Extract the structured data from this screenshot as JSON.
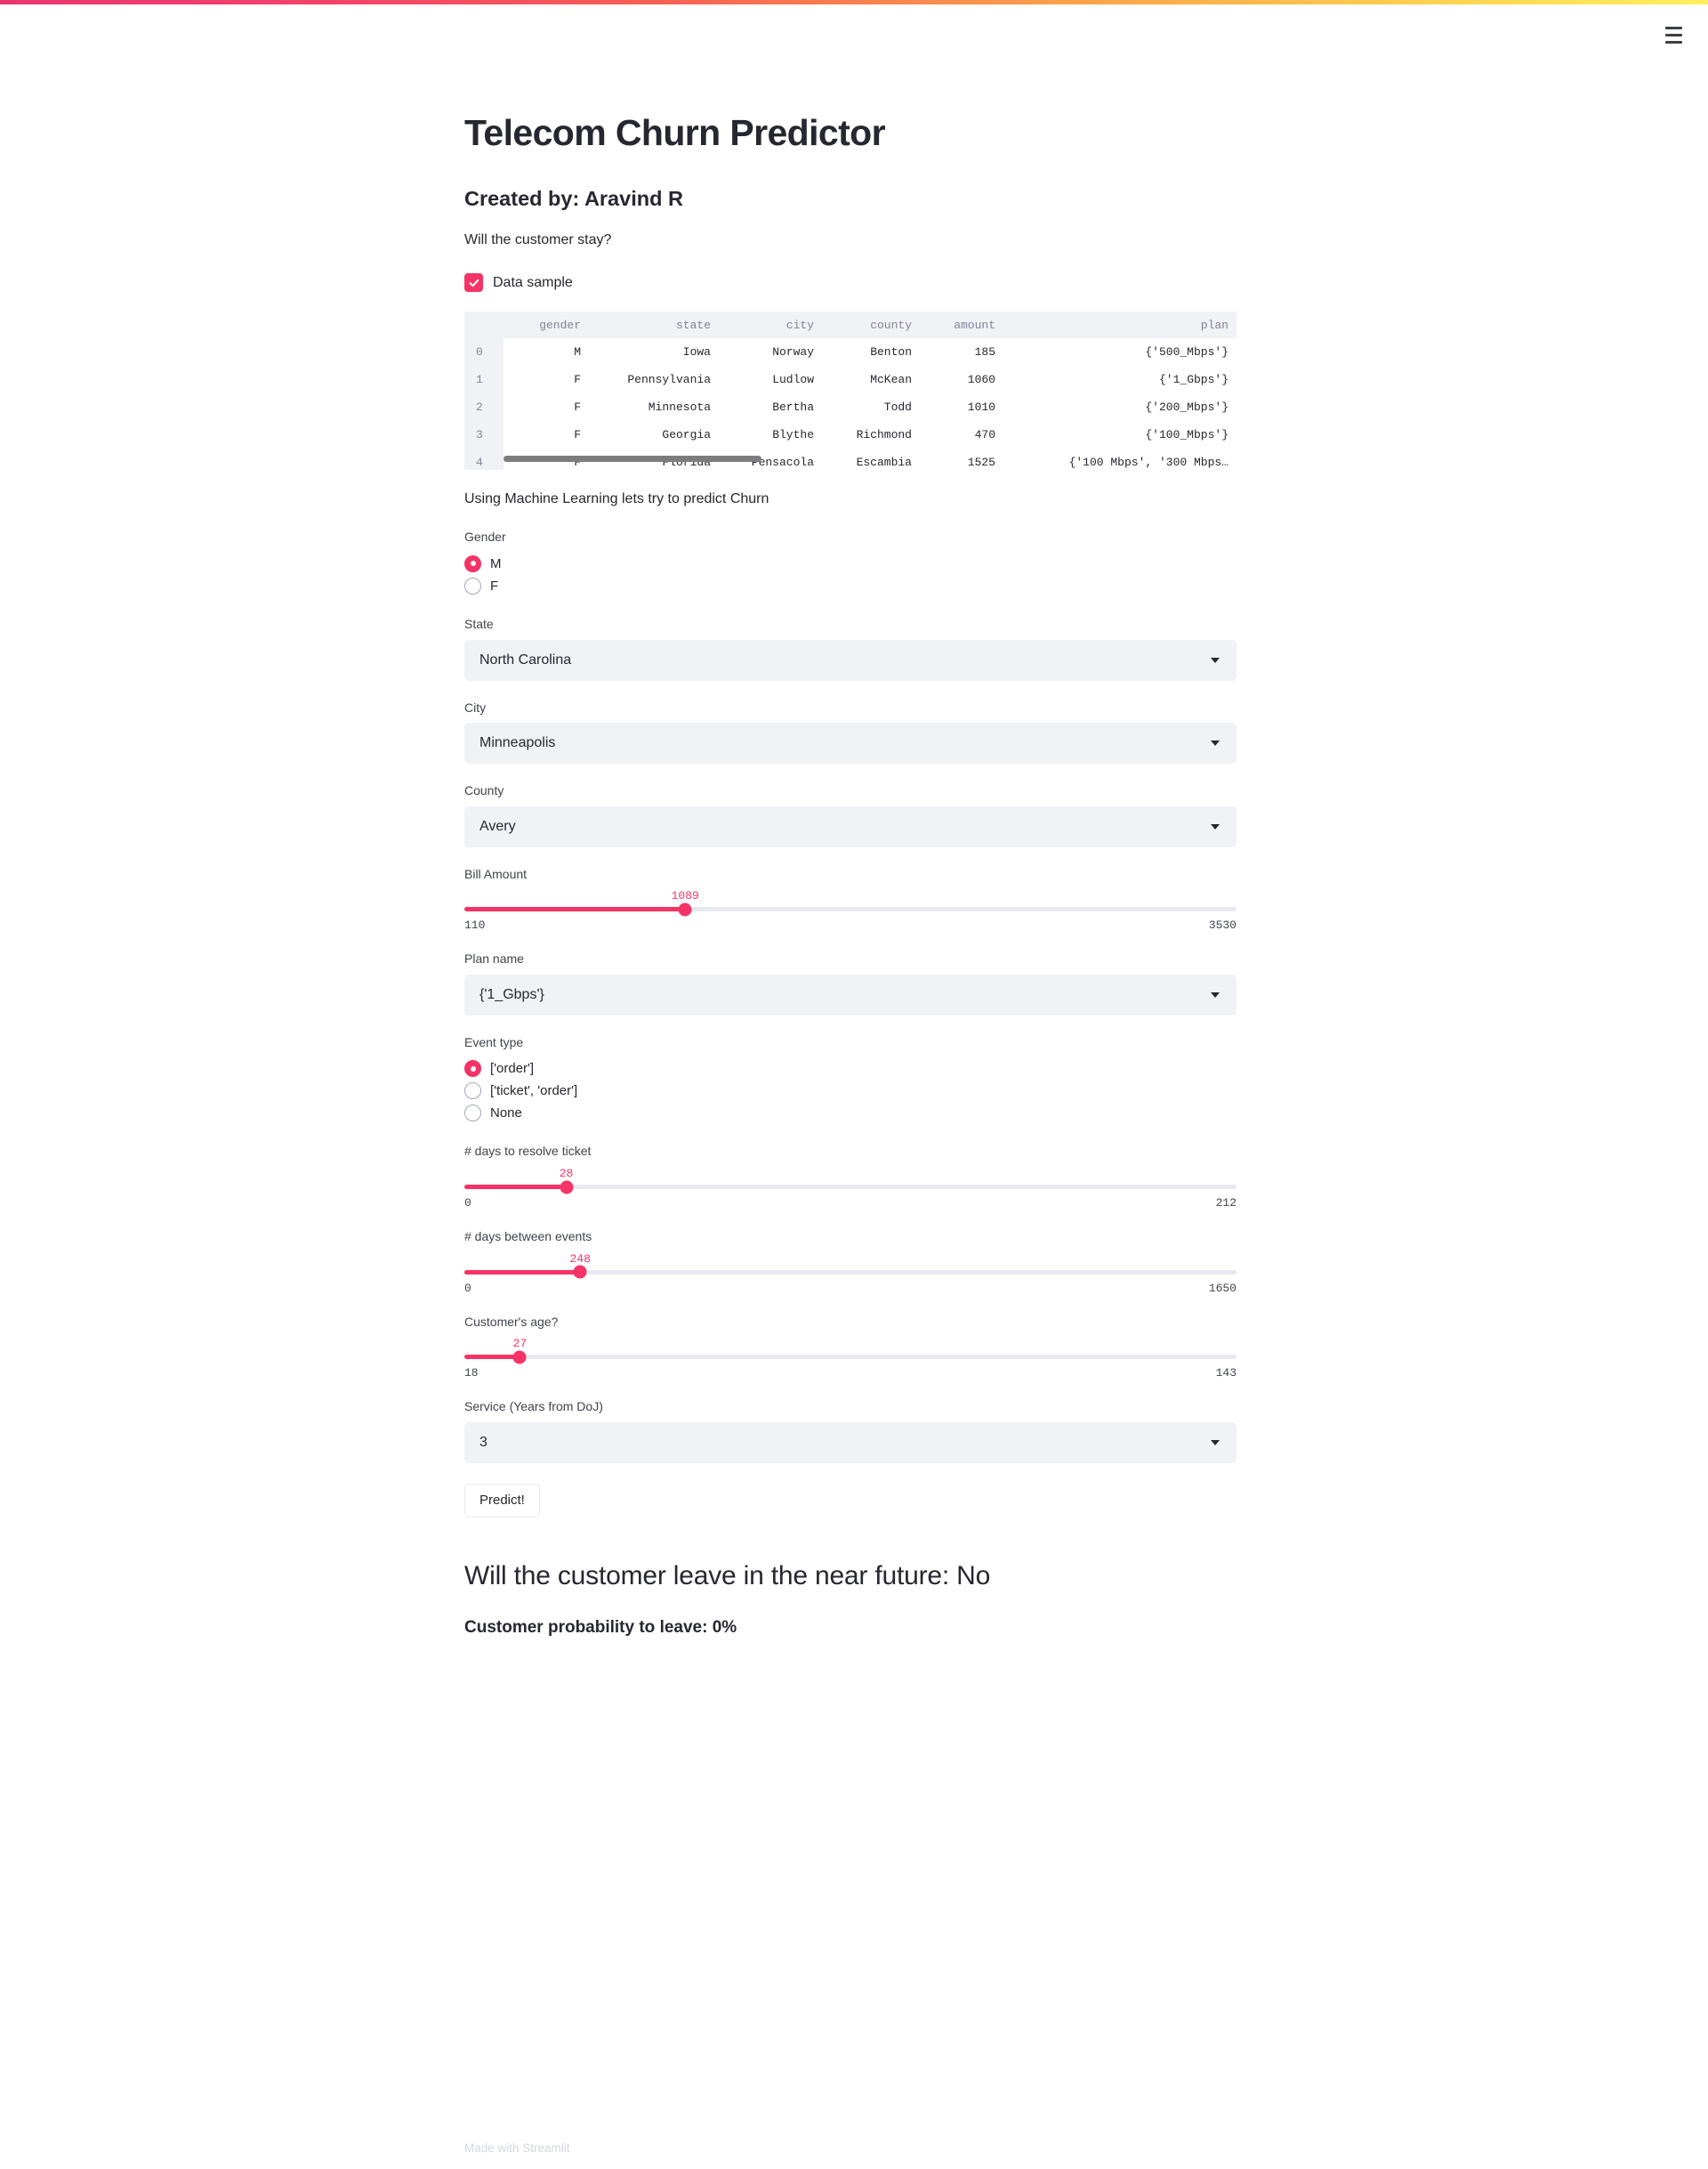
{
  "theme": {
    "accent": "#f63366",
    "widget_bg": "#f0f2f6",
    "text": "#262730",
    "muted": "#808495",
    "track": "#e6e9ef"
  },
  "header": {
    "menu_icon": "hamburger-menu-icon"
  },
  "title": "Telecom Churn Predictor",
  "created_by": "Created by: Aravind R",
  "lead": "Will the customer stay?",
  "data_sample": {
    "label": "Data sample",
    "checked": true
  },
  "dataframe": {
    "index_header": "",
    "columns": [
      "gender",
      "state",
      "city",
      "county",
      "amount",
      "plan"
    ],
    "rows": [
      {
        "index": "0",
        "gender": "M",
        "state": "Iowa",
        "city": "Norway",
        "county": "Benton",
        "amount": "185",
        "plan": "{'500_Mbps'}"
      },
      {
        "index": "1",
        "gender": "F",
        "state": "Pennsylvania",
        "city": "Ludlow",
        "county": "McKean",
        "amount": "1060",
        "plan": "{'1_Gbps'}"
      },
      {
        "index": "2",
        "gender": "F",
        "state": "Minnesota",
        "city": "Bertha",
        "county": "Todd",
        "amount": "1010",
        "plan": "{'200_Mbps'}"
      },
      {
        "index": "3",
        "gender": "F",
        "state": "Georgia",
        "city": "Blythe",
        "county": "Richmond",
        "amount": "470",
        "plan": "{'100_Mbps'}"
      },
      {
        "index": "4",
        "gender": "F",
        "state": "Florida",
        "city": "Pensacola",
        "county": "Escambia",
        "amount": "1525",
        "plan": "{'100 Mbps', '300 Mbps…"
      }
    ]
  },
  "ml_intro": "Using Machine Learning lets try to predict Churn",
  "form": {
    "gender": {
      "label": "Gender",
      "options": [
        "M",
        "F"
      ],
      "selected": "M"
    },
    "state": {
      "label": "State",
      "value": "North Carolina"
    },
    "city": {
      "label": "City",
      "value": "Minneapolis"
    },
    "county": {
      "label": "County",
      "value": "Avery"
    },
    "bill_amount": {
      "label": "Bill Amount",
      "value": "1089",
      "min": "110",
      "max": "3530",
      "percent": 28.6
    },
    "plan_name": {
      "label": "Plan name",
      "value": "{'1_Gbps'}"
    },
    "event_type": {
      "label": "Event type",
      "options": [
        "['order']",
        "['ticket', 'order']",
        "None"
      ],
      "selected": "['order']"
    },
    "days_resolve": {
      "label": "# days to resolve ticket",
      "value": "28",
      "min": "0",
      "max": "212",
      "percent": 13.2
    },
    "days_between": {
      "label": "# days between events",
      "value": "248",
      "min": "0",
      "max": "1650",
      "percent": 15.0
    },
    "age": {
      "label": "Customer's age?",
      "value": "27",
      "min": "18",
      "max": "143",
      "percent": 7.2
    },
    "service_years": {
      "label": "Service (Years from DoJ)",
      "value": "3"
    },
    "predict_button": "Predict!"
  },
  "result": {
    "heading": "Will the customer leave in the near future: No",
    "probability": "Customer probability to leave: 0%"
  },
  "footer": "Made with Streamlit"
}
